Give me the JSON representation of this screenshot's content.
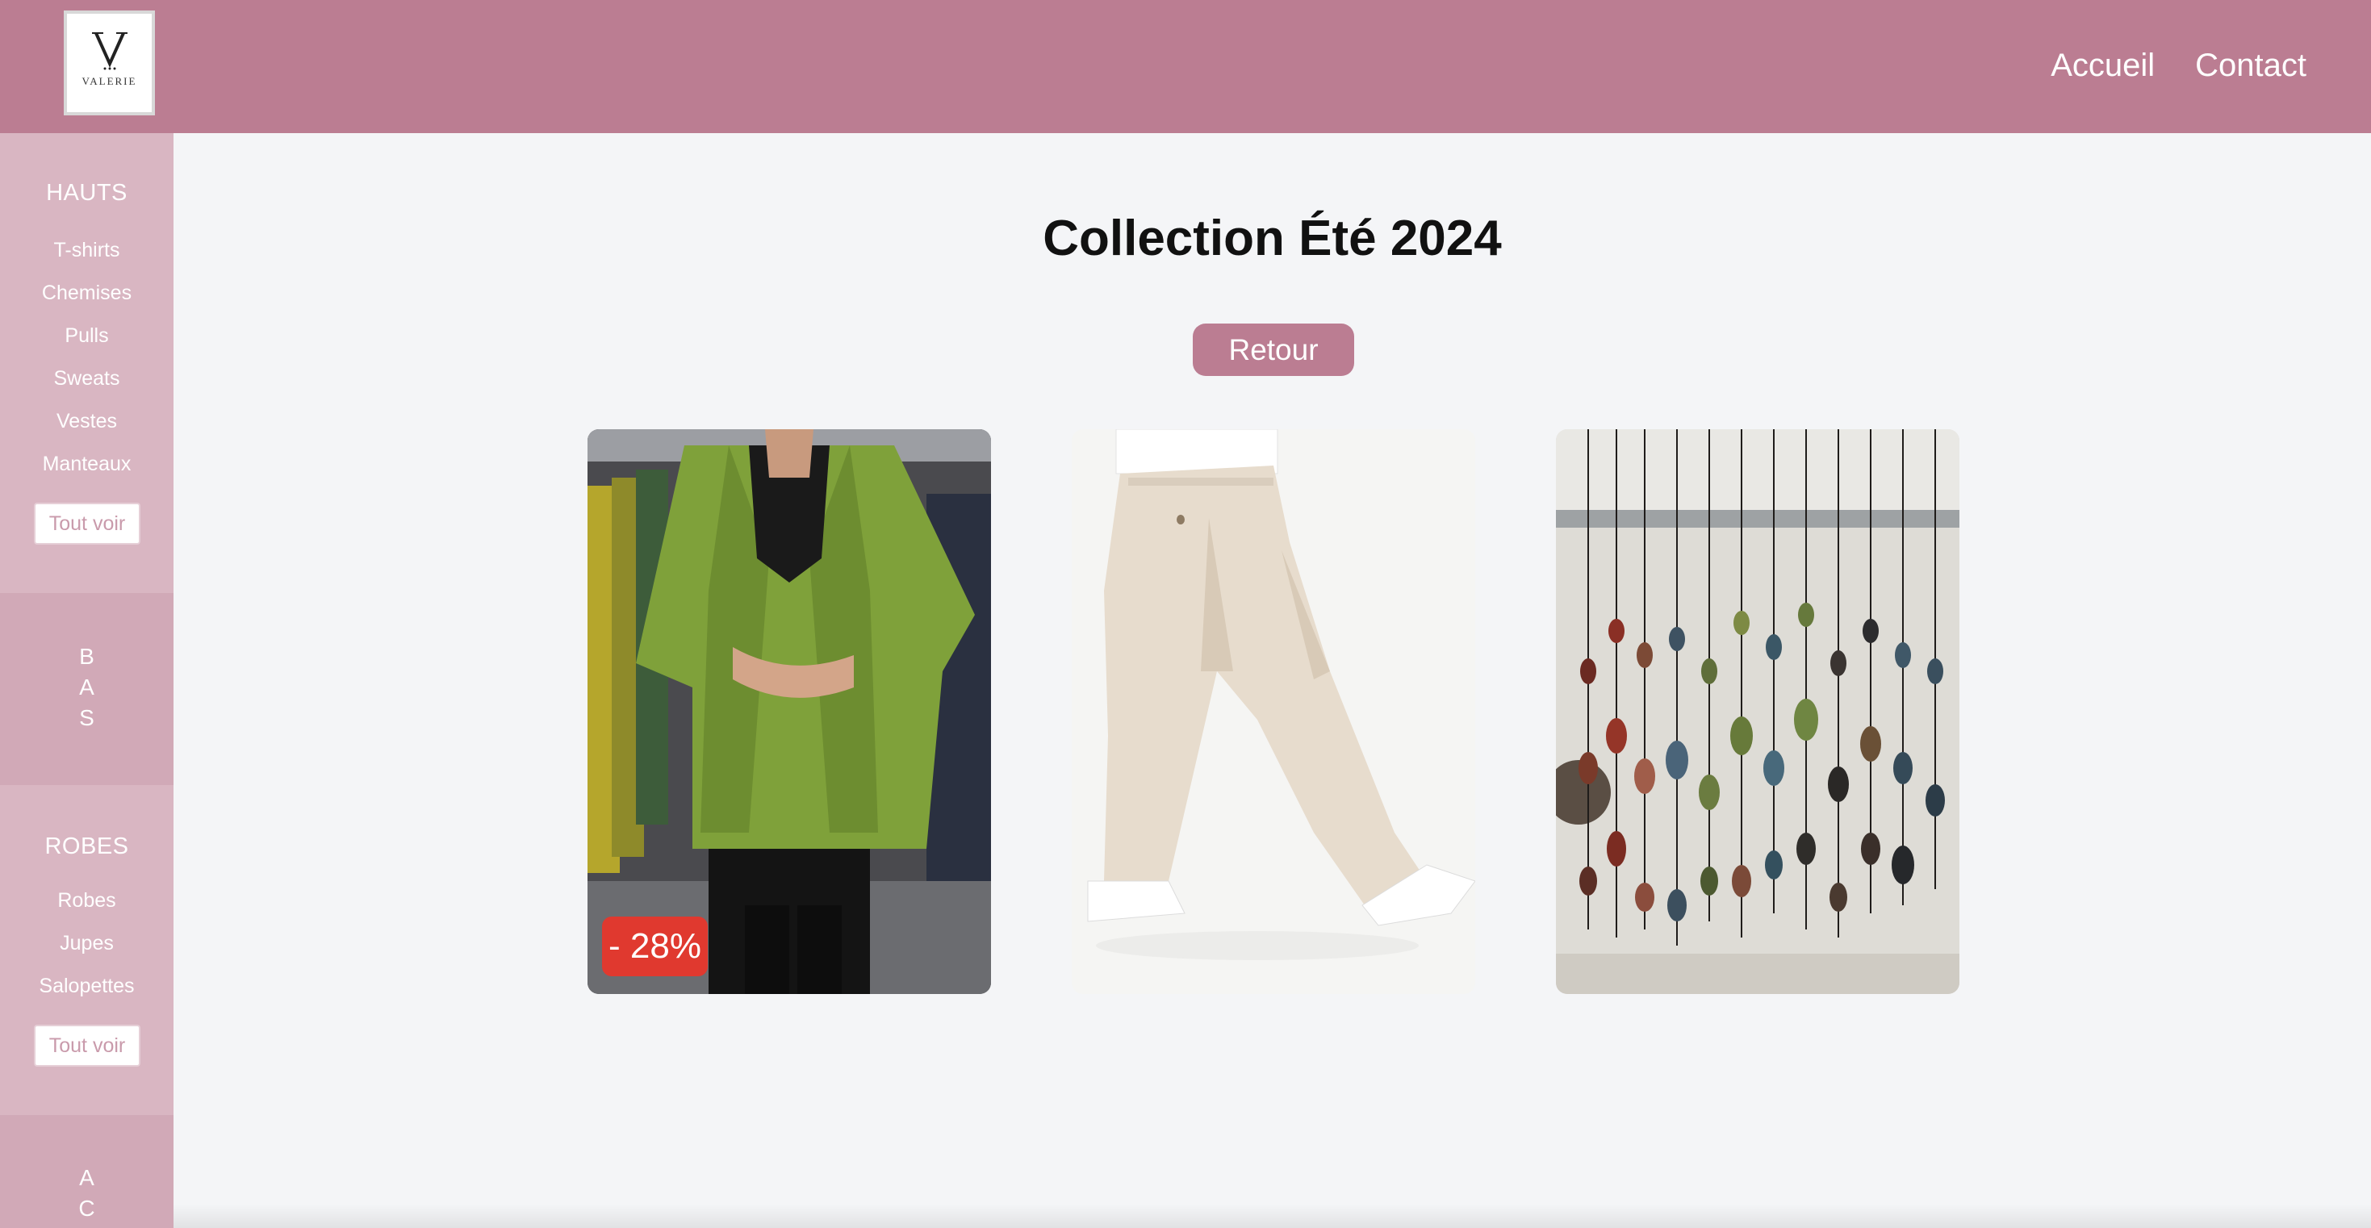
{
  "header": {
    "logo_letter": "V",
    "logo_word": "VALERIE",
    "nav": [
      "Accueil",
      "Contact"
    ]
  },
  "sidebar": {
    "hauts": {
      "title": "HAUTS",
      "items": [
        "T-shirts",
        "Chemises",
        "Pulls",
        "Sweats",
        "Vestes",
        "Manteaux"
      ],
      "button": "Tout voir"
    },
    "bas": {
      "letters": [
        "B",
        "A",
        "S"
      ]
    },
    "robes": {
      "title": "ROBES",
      "items": [
        "Robes",
        "Jupes",
        "Salopettes"
      ],
      "button": "Tout voir"
    },
    "acc": {
      "letters": [
        "A",
        "C"
      ]
    }
  },
  "main": {
    "title": "Collection Été 2024",
    "back_button": "Retour",
    "products": [
      {
        "image": "green-wool-jacket-photo",
        "badge": "- 28%"
      },
      {
        "image": "beige-trousers-photo"
      },
      {
        "image": "beaded-necklaces-photo"
      }
    ]
  },
  "colors": {
    "brand": "#bb7d92",
    "sidebar": "#d9b6c2",
    "badge": "#e0392f",
    "background": "#f4f5f7"
  }
}
